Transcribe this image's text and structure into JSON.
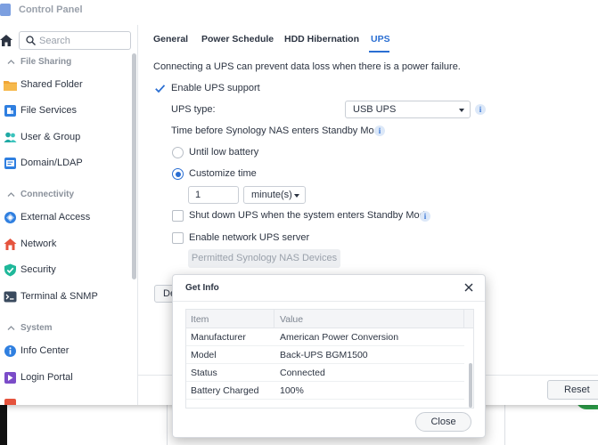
{
  "window": {
    "title": "Control Panel"
  },
  "sidebar": {
    "search_placeholder": "Search",
    "sections": [
      {
        "label": "File Sharing",
        "items": [
          {
            "label": "Shared Folder",
            "icon": "shared-folder-icon"
          },
          {
            "label": "File Services",
            "icon": "file-services-icon"
          },
          {
            "label": "User & Group",
            "icon": "user-group-icon"
          },
          {
            "label": "Domain/LDAP",
            "icon": "domain-ldap-icon"
          }
        ]
      },
      {
        "label": "Connectivity",
        "items": [
          {
            "label": "External Access",
            "icon": "external-access-icon"
          },
          {
            "label": "Network",
            "icon": "network-icon"
          },
          {
            "label": "Security",
            "icon": "security-icon"
          },
          {
            "label": "Terminal & SNMP",
            "icon": "terminal-icon"
          }
        ]
      },
      {
        "label": "System",
        "items": [
          {
            "label": "Info Center",
            "icon": "info-center-icon"
          },
          {
            "label": "Login Portal",
            "icon": "login-portal-icon"
          }
        ]
      }
    ]
  },
  "tabs": [
    {
      "label": "General",
      "active": false
    },
    {
      "label": "Power Schedule",
      "active": false
    },
    {
      "label": "HDD Hibernation",
      "active": false
    },
    {
      "label": "UPS",
      "active": true
    }
  ],
  "ups": {
    "description": "Connecting a UPS can prevent data loss when there is a power failure.",
    "enable_label": "Enable UPS support",
    "enable_checked": true,
    "type_label": "UPS type:",
    "type_value": "USB UPS",
    "standby_label": "Time before Synology NAS enters Standby Mode",
    "option_low_battery": "Until low battery",
    "option_customize": "Customize time",
    "customize_selected": true,
    "time_value": "1",
    "time_unit": "minute(s)",
    "shutdown_label": "Shut down UPS when the system enters Standby Mode",
    "shutdown_checked": false,
    "network_server_label": "Enable network UPS server",
    "network_server_checked": false,
    "permitted_button": "Permitted Synology NAS Devices",
    "partial_button": "De"
  },
  "footer": {
    "reset_label": "Reset"
  },
  "dialog": {
    "title": "Get Info",
    "columns": [
      "Item",
      "Value"
    ],
    "rows": [
      [
        "Manufacturer",
        "American Power Conversion"
      ],
      [
        "Model",
        "Back-UPS BGM1500"
      ],
      [
        "Status",
        "Connected"
      ],
      [
        "Battery Charged",
        "100%"
      ]
    ],
    "close_label": "Close"
  },
  "colors": {
    "accent": "#2a6ed2",
    "text": "#2c3442",
    "muted": "#9aa1ab"
  }
}
